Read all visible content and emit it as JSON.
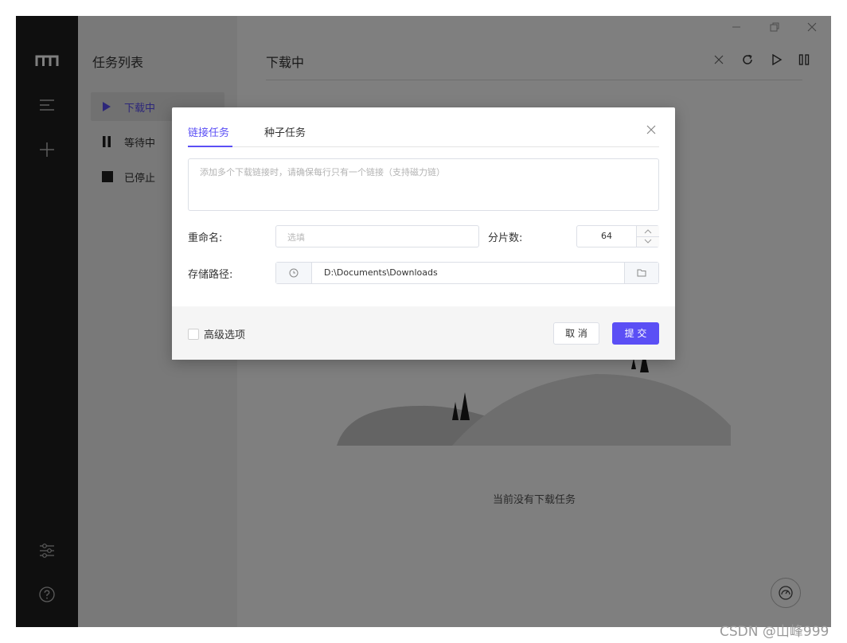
{
  "sidebar": {
    "icons": [
      "menu-lines-icon",
      "plus-icon",
      "sliders-icon",
      "help-icon"
    ]
  },
  "task_panel": {
    "title": "任务列表",
    "items": [
      {
        "label": "下载中",
        "icon": "play-icon",
        "active": true
      },
      {
        "label": "等待中",
        "icon": "pause-icon",
        "active": false
      },
      {
        "label": "已停止",
        "icon": "stop-icon",
        "active": false
      }
    ]
  },
  "main": {
    "title": "下载中",
    "tools": [
      "close-icon",
      "refresh-icon",
      "play-icon",
      "pause-icon"
    ],
    "empty_text": "当前没有下载任务"
  },
  "dialog": {
    "tabs": [
      "链接任务",
      "种子任务"
    ],
    "active_tab": 0,
    "links_placeholder": "添加多个下载链接时，请确保每行只有一个链接（支持磁力链）",
    "rename_label": "重命名:",
    "rename_placeholder": "选填",
    "slices_label": "分片数:",
    "slices_value": "64",
    "path_label": "存储路径:",
    "path_value": "D:\\Documents\\Downloads",
    "advanced_label": "高级选项",
    "cancel_label": "取 消",
    "submit_label": "提 交"
  },
  "colors": {
    "accent": "#5b4ff5",
    "sidebar_bg": "#1e1e1e",
    "panel_bg": "#f3f3f3"
  },
  "watermark": "CSDN @山峰999"
}
